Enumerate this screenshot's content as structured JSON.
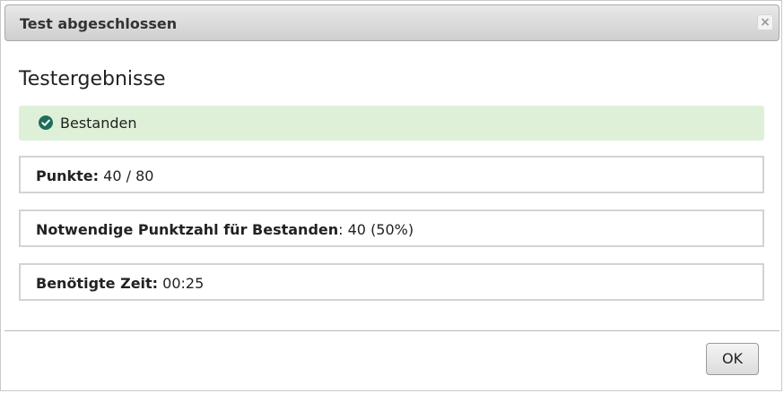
{
  "dialog": {
    "title": "Test abgeschlossen",
    "close_symbol": "×"
  },
  "results": {
    "heading": "Testergebnisse",
    "status": {
      "icon": "check-circle-icon",
      "label": "Bestanden",
      "background_color": "#dff0d8",
      "icon_color": "#1f6e5a"
    },
    "points": {
      "label": "Punkte:",
      "value": "40 / 80"
    },
    "required": {
      "label": "Notwendige Punktzahl für Bestanden",
      "value": ": 40 (50%)"
    },
    "time": {
      "label": "Benötigte Zeit:",
      "value": "00:25"
    }
  },
  "footer": {
    "ok_label": "OK"
  }
}
